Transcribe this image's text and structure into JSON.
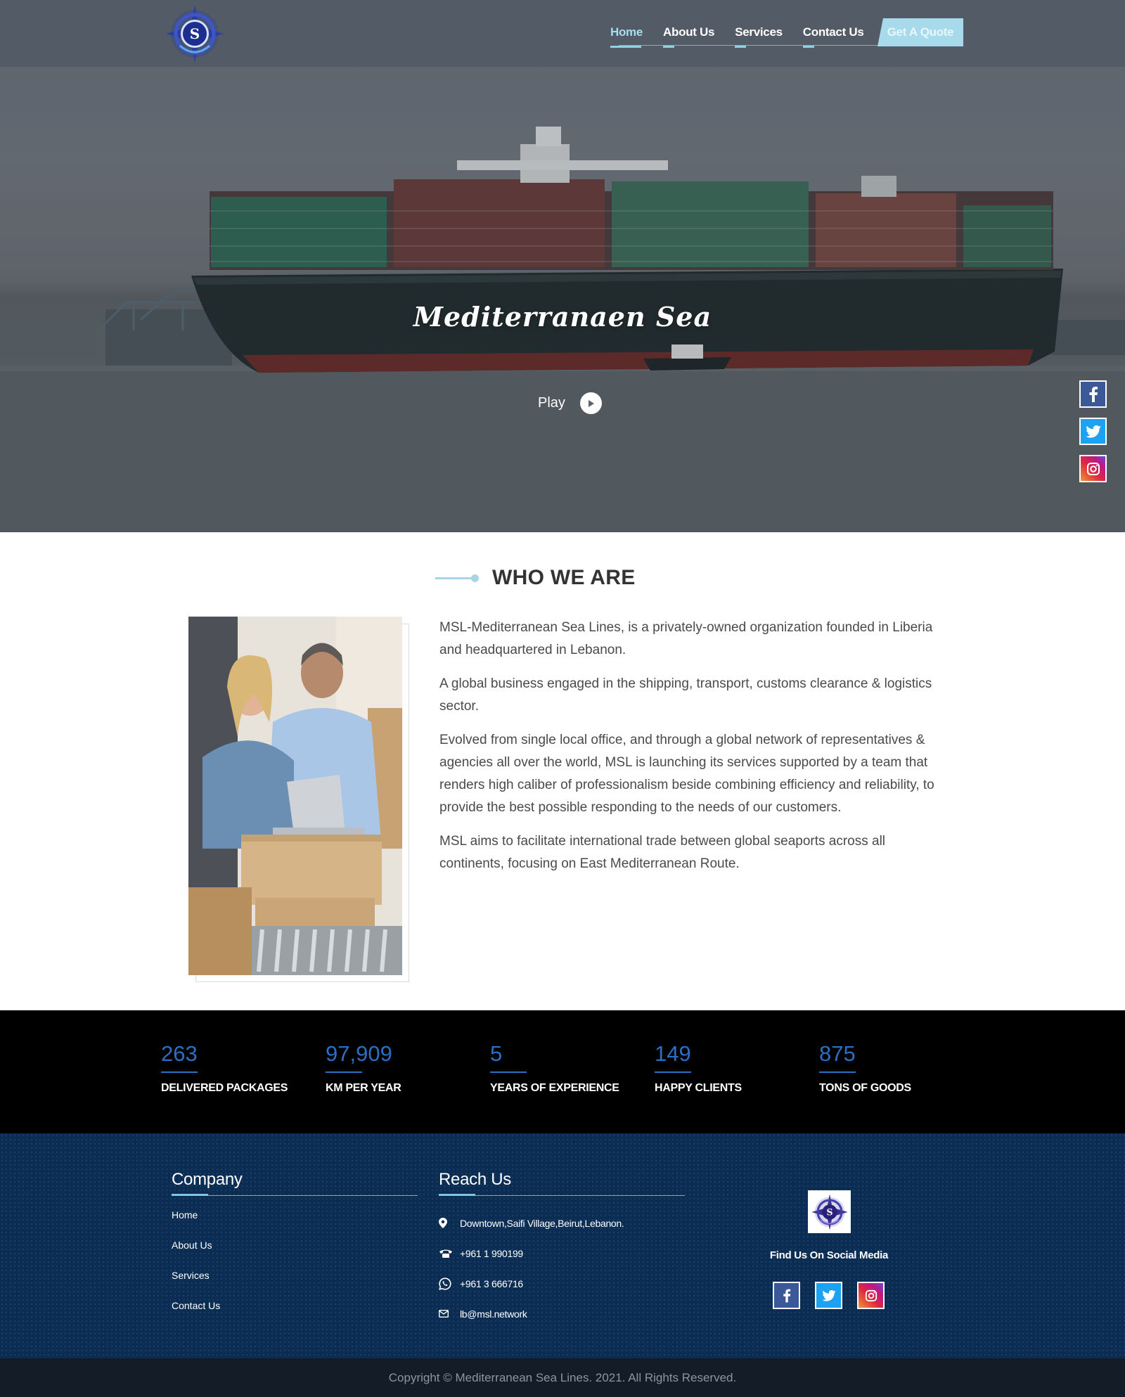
{
  "nav": {
    "items": [
      "Home",
      "About Us",
      "Services",
      "Contact Us"
    ],
    "active": "Home",
    "quote_label": "Get A Quote"
  },
  "hero": {
    "title": "Mediterranaen Sea",
    "play_label": "Play"
  },
  "side_social": [
    "facebook-icon",
    "twitter-icon",
    "instagram-icon"
  ],
  "who": {
    "title": "WHO WE ARE",
    "paragraphs": [
      "MSL-Mediterranean Sea Lines, is a privately-owned organization founded in Liberia and headquartered in Lebanon.",
      "A global business engaged in the shipping, transport, customs clearance & logistics sector.",
      "Evolved from single local office, and through a global network of representatives & agencies all over the world, MSL is launching its services supported by a team that renders high caliber of professionalism beside combining efficiency and reliability, to provide the best possible responding to the needs of our customers.",
      "MSL aims to facilitate international trade between global seaports across all continents, focusing on East Mediterranean Route."
    ]
  },
  "stats": [
    {
      "value": "263",
      "label": "DELIVERED PACKAGES"
    },
    {
      "value": "97,909",
      "label": "KM PER YEAR"
    },
    {
      "value": "5",
      "label": "YEARS OF EXPERIENCE"
    },
    {
      "value": "149",
      "label": "HAPPY CLIENTS"
    },
    {
      "value": "875",
      "label": "TONS OF GOODS"
    }
  ],
  "footer": {
    "company_title": "Company",
    "company_links": [
      "Home",
      "About Us",
      "Services",
      "Contact Us"
    ],
    "reach_title": "Reach Us",
    "address": "Downtown,Saifi Village,Beirut,Lebanon.",
    "phone": "+961 1 990199",
    "whatsapp": "+961 3 666716",
    "email": "lb@msl.network",
    "find_us": "Find Us On Social Media"
  },
  "copyright": "Copyright © Mediterranean Sea Lines. 2021. All Rights Reserved.",
  "colors": {
    "accent": "#a7dbeb",
    "counter_blue": "#2a6fc4",
    "footer_bg": "#0c2d53",
    "facebook": "#3b5998",
    "twitter": "#1da1f2",
    "instagram": "#c13584"
  }
}
